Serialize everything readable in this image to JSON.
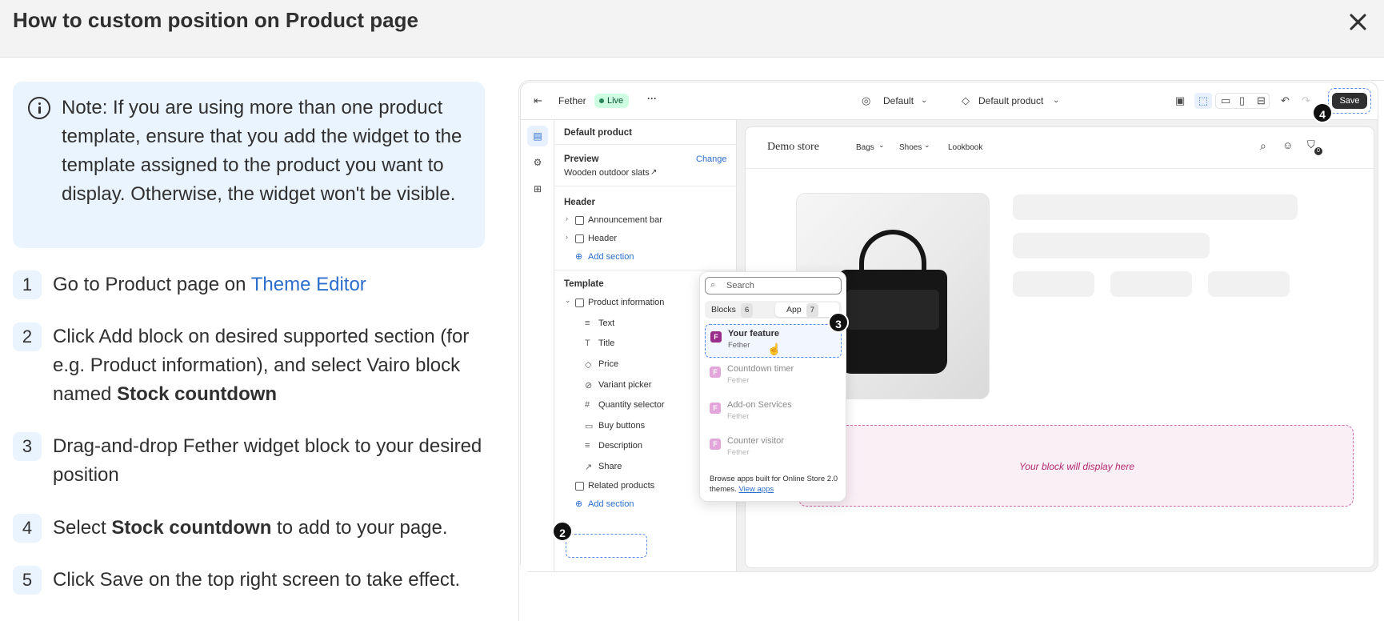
{
  "modal": {
    "title": "How to custom position on Product page"
  },
  "note": {
    "text": "Note: If you are using more than one product template, ensure that you add the widget to the template assigned to the product you want to display. Otherwise, the widget won't be visible."
  },
  "steps": [
    {
      "num": "1",
      "before": "Go to Product page on ",
      "link": "Theme Editor"
    },
    {
      "num": "2",
      "before": "Click Add block on desired supported section (for e.g. Product information), and select Vairo block named ",
      "bold": "Stock countdown"
    },
    {
      "num": "3",
      "before": "Drag-and-drop Fether widget block to your desired position"
    },
    {
      "num": "4",
      "before": "Select ",
      "bold": "Stock countdown",
      "after": " to add to your page."
    },
    {
      "num": "5",
      "before": "Click Save on the top right screen to take effect."
    }
  ],
  "editor": {
    "app_name": "Fether",
    "live": "Live",
    "more": "···",
    "theme_select": "Default",
    "template_select": "Default product",
    "save": "Save",
    "badges": [
      "2",
      "3",
      "4"
    ],
    "sidebar": {
      "title": "Default product",
      "preview_label": "Preview",
      "change": "Change",
      "preview_product": "Wooden outdoor slats",
      "header_group": "Header",
      "header_items": [
        "Announcement bar",
        "Header"
      ],
      "add_section": "Add section",
      "template_group": "Template",
      "template_section": "Product information",
      "blocks": [
        {
          "icon": "≡",
          "label": "Text"
        },
        {
          "icon": "T",
          "label": "Title"
        },
        {
          "icon": "◇",
          "label": "Price"
        },
        {
          "icon": "⊘",
          "label": "Variant picker"
        },
        {
          "icon": "#",
          "label": "Quantity selector"
        },
        {
          "icon": "▭",
          "label": "Buy buttons"
        },
        {
          "icon": "≡",
          "label": "Description"
        },
        {
          "icon": "↗",
          "label": "Share"
        }
      ],
      "related": "Related products",
      "add_section_bottom": "Add section"
    },
    "preview": {
      "store_name": "Demo store",
      "nav": [
        "Bags",
        "Shoes",
        "Lookbook"
      ],
      "cart_count": "0",
      "drop_text": "Your block will display here"
    },
    "popover": {
      "search_placeholder": "Search",
      "tabs": [
        {
          "label": "Blocks",
          "count": "6"
        },
        {
          "label": "App",
          "count": "7"
        }
      ],
      "items": [
        {
          "title": "Your feature",
          "sub": "Fether"
        },
        {
          "title": "Countdown timer",
          "sub": "Fether"
        },
        {
          "title": "Add-on Services",
          "sub": "Fether"
        },
        {
          "title": "Counter visitor",
          "sub": "Fether"
        }
      ],
      "footer_text": "Browse apps built for Online Store 2.0 themes.",
      "footer_link": "View apps"
    }
  },
  "colors": {
    "accent_blue": "#2c6ecb",
    "note_bg": "#eaf4ff",
    "drop_zone_text": "#b1296f",
    "live_green": "#29845a"
  }
}
